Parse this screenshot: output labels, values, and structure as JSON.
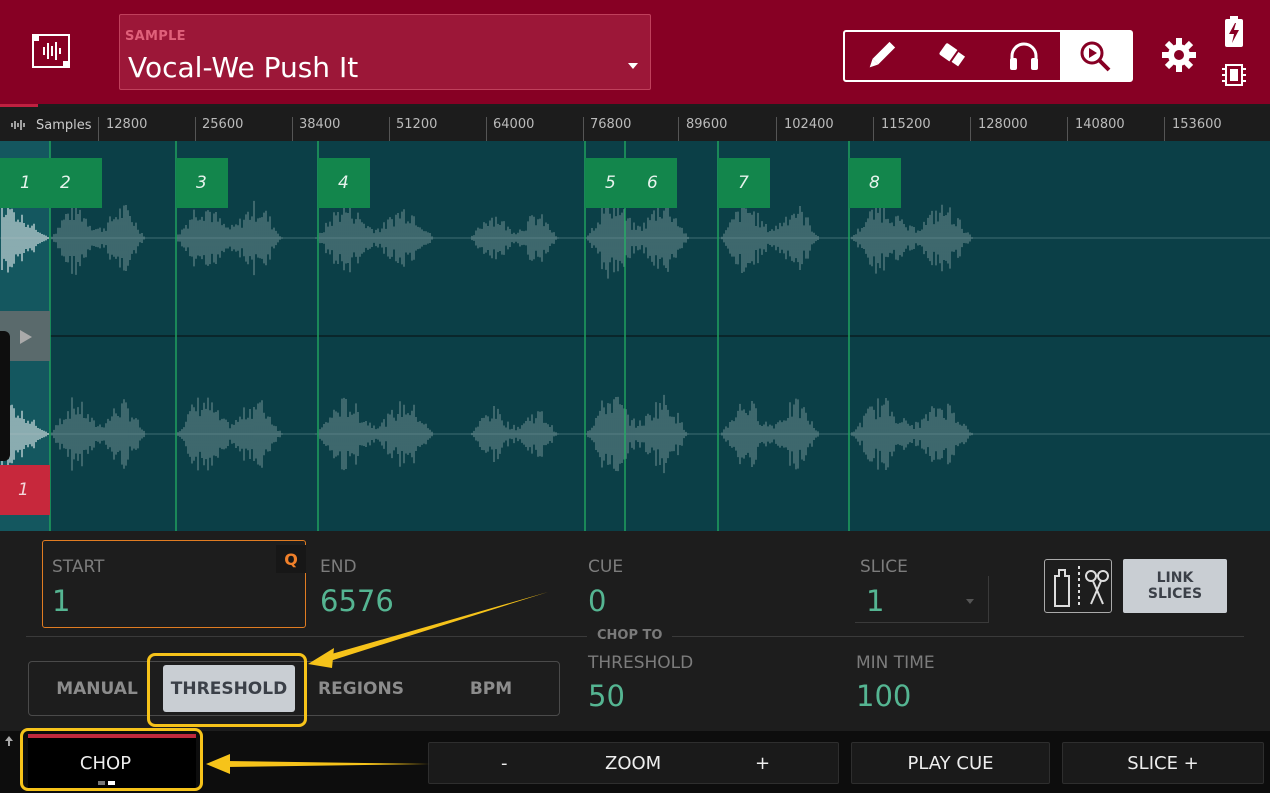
{
  "header": {
    "sample_label": "SAMPLE",
    "sample_name": "Vocal-We Push It",
    "tools": [
      "pencil-icon",
      "eraser-icon",
      "headphones-icon",
      "zoom-icon"
    ],
    "active_tool": "zoom-icon",
    "accent_color": "#870024"
  },
  "ruler": {
    "unit_label": "Samples",
    "ticks": [
      "12800",
      "25600",
      "38400",
      "51200",
      "64000",
      "76800",
      "89600",
      "102400",
      "115200",
      "128000",
      "140800",
      "153600"
    ]
  },
  "waveform": {
    "slice_tags": [
      "1",
      "2",
      "3",
      "4",
      "5",
      "6",
      "7",
      "8"
    ],
    "lower_tag": "1"
  },
  "params": {
    "start_label": "START",
    "start_value": "1",
    "q_badge": "Q",
    "end_label": "END",
    "end_value": "6576",
    "cue_label": "CUE",
    "cue_value": "0",
    "slice_label": "SLICE",
    "slice_value": "1",
    "link_slices": "LINK SLICES",
    "chop_to": "CHOP TO",
    "threshold_label": "THRESHOLD",
    "threshold_value": "50",
    "min_time_label": "MIN TIME",
    "min_time_value": "100"
  },
  "modes": {
    "items": [
      "MANUAL",
      "THRESHOLD",
      "REGIONS",
      "BPM"
    ],
    "active": "THRESHOLD"
  },
  "bottom": {
    "chop": "CHOP",
    "zoom_minus": "-",
    "zoom": "ZOOM",
    "zoom_plus": "+",
    "play_cue": "PLAY CUE",
    "slice_plus": "SLICE +"
  }
}
